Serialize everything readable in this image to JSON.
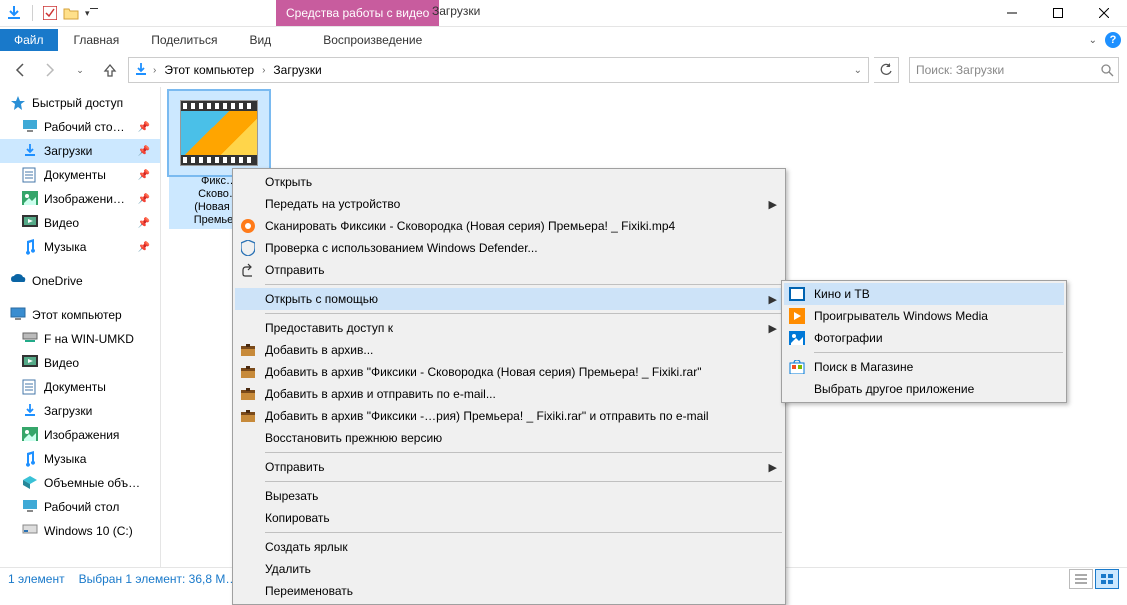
{
  "window": {
    "title": "Загрузки",
    "contextual_tab": "Средства работы с видео"
  },
  "ribbon": {
    "file": "Файл",
    "tabs": [
      "Главная",
      "Поделиться",
      "Вид"
    ],
    "contextual_group": "Воспроизведение"
  },
  "breadcrumb": {
    "items": [
      "Этот компьютер",
      "Загрузки"
    ]
  },
  "search": {
    "placeholder": "Поиск: Загрузки"
  },
  "nav_pane": {
    "quick_access": "Быстрый доступ",
    "quick_items": [
      {
        "label": "Рабочий сто…",
        "icon": "desktop"
      },
      {
        "label": "Загрузки",
        "icon": "downloads",
        "selected": true
      },
      {
        "label": "Документы",
        "icon": "documents"
      },
      {
        "label": "Изображени…",
        "icon": "pictures"
      },
      {
        "label": "Видео",
        "icon": "videos"
      },
      {
        "label": "Музыка",
        "icon": "music"
      }
    ],
    "onedrive": "OneDrive",
    "this_pc": "Этот компьютер",
    "pc_items": [
      {
        "label": "F на WIN-UMKD",
        "icon": "netdrive"
      },
      {
        "label": "Видео",
        "icon": "videos"
      },
      {
        "label": "Документы",
        "icon": "documents"
      },
      {
        "label": "Загрузки",
        "icon": "downloads"
      },
      {
        "label": "Изображения",
        "icon": "pictures"
      },
      {
        "label": "Музыка",
        "icon": "music"
      },
      {
        "label": "Объемные объ…",
        "icon": "3d"
      },
      {
        "label": "Рабочий стол",
        "icon": "desktop"
      },
      {
        "label": "Windows 10 (C:)",
        "icon": "disk"
      }
    ]
  },
  "file_item": {
    "name_lines": [
      "Фикс…",
      "Сково…",
      "(Новая …",
      "Премье…"
    ]
  },
  "context_menu": {
    "open": "Открыть",
    "cast": "Передать на устройство",
    "avast_scan": "Сканировать Фиксики - Сковородка (Новая серия) Премьера! _ Fixiki.mp4",
    "defender": "Проверка с использованием Windows Defender...",
    "send": "Отправить",
    "open_with": "Открыть с помощью",
    "give_access": "Предоставить доступ к",
    "rar_add": "Добавить в архив...",
    "rar_add_named": "Добавить в архив \"Фиксики - Сковородка (Новая серия) Премьера! _ Fixiki.rar\"",
    "rar_email": "Добавить в архив и отправить по e-mail...",
    "rar_email_named": "Добавить в архив \"Фиксики -…рия) Премьера! _ Fixiki.rar\" и отправить по e-mail",
    "restore": "Восстановить прежнюю версию",
    "send_to": "Отправить",
    "cut": "Вырезать",
    "copy": "Копировать",
    "shortcut": "Создать ярлык",
    "delete": "Удалить",
    "rename": "Переименовать"
  },
  "submenu": {
    "movies_tv": "Кино и ТВ",
    "wmp": "Проигрыватель Windows Media",
    "photos": "Фотографии",
    "store": "Поиск в Магазине",
    "choose": "Выбрать другое приложение"
  },
  "status": {
    "count": "1 элемент",
    "selection": "Выбран 1 элемент: 36,8 М…"
  }
}
